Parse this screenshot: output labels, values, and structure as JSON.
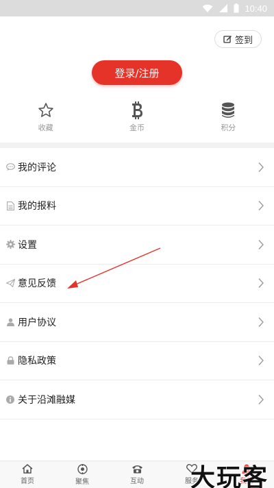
{
  "status_bar": {
    "time": "10:40"
  },
  "header": {
    "checkin_label": "签到",
    "login_label": "登录/注册"
  },
  "stats": [
    {
      "icon": "star-icon",
      "label": "收藏"
    },
    {
      "icon": "bitcoin-icon",
      "label": "金币"
    },
    {
      "icon": "database-icon",
      "label": "积分"
    }
  ],
  "menu": [
    {
      "icon": "comment-icon",
      "label": "我的评论"
    },
    {
      "icon": "document-icon",
      "label": "我的报料"
    },
    {
      "icon": "gear-icon",
      "label": "设置"
    },
    {
      "icon": "paper-plane-icon",
      "label": "意见反馈"
    },
    {
      "icon": "user-icon",
      "label": "用户协议"
    },
    {
      "icon": "lock-icon",
      "label": "隐私政策"
    },
    {
      "icon": "info-icon",
      "label": "关于沿滩融媒"
    }
  ],
  "tabs": [
    {
      "icon": "home-icon",
      "label": "首页"
    },
    {
      "icon": "focus-icon",
      "label": "聚焦"
    },
    {
      "icon": "phone-icon",
      "label": "互动"
    },
    {
      "icon": "heart-icon",
      "label": "服务"
    },
    {
      "icon": "profile-icon",
      "label": "我的"
    }
  ],
  "watermark": "大玩客",
  "colors": {
    "accent": "#e5332a",
    "icon_gray": "#999999"
  }
}
